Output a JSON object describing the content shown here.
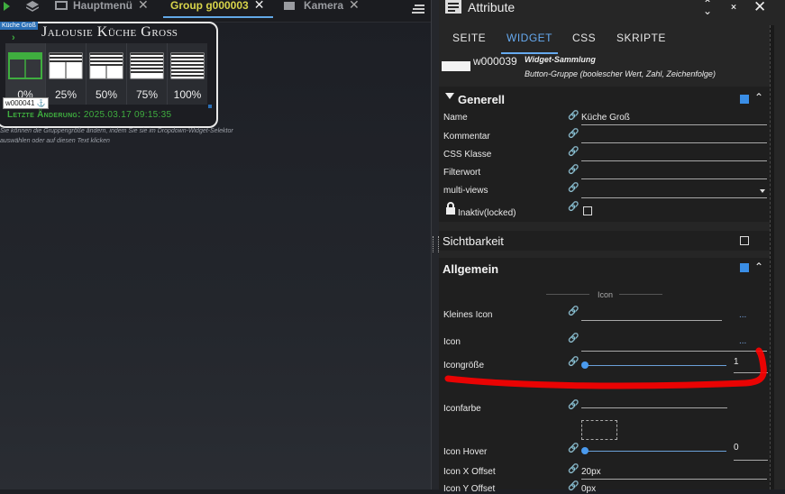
{
  "topbar": {
    "tabs": [
      {
        "label": "Hauptmenü"
      },
      {
        "label": "Group g000003"
      },
      {
        "label": "Kamera"
      }
    ]
  },
  "canvas": {
    "selection_label": "Küche Groß",
    "widget_title": "Jalousie Küche Groß",
    "widget_id": "w000041",
    "buttons": [
      {
        "label": "0%",
        "selected": true
      },
      {
        "label": "25%",
        "selected": false
      },
      {
        "label": "50%",
        "selected": false
      },
      {
        "label": "75%",
        "selected": false
      },
      {
        "label": "100%",
        "selected": false
      }
    ],
    "last_change_label": "Letzte Änderung:",
    "last_change_value": "2025.03.17 09:15:35",
    "hint": "Sie können die Gruppengröße ändern, indem Sie sie im Dropdown-Widget-Selektor auswählen oder auf diesen Text klicken"
  },
  "panel": {
    "title": "Attribute",
    "tabs": [
      "SEITE",
      "WIDGET",
      "CSS",
      "SKRIPTE"
    ],
    "active_tab": "WIDGET",
    "widget_id": "w000039",
    "widget_type": "Widget-Sammlung",
    "widget_desc": "Button-Gruppe (boolescher Wert, Zahl, Zeichenfolge)",
    "generell": {
      "title": "Generell",
      "rows": {
        "name_label": "Name",
        "name_value": "Küche Groß",
        "kommentar_label": "Kommentar",
        "css_label": "CSS Klasse",
        "filter_label": "Filterwort",
        "multiviews_label": "multi-views",
        "inaktiv_label": "Inaktiv(locked)"
      }
    },
    "sichtbarkeit": {
      "title": "Sichtbarkeit"
    },
    "allgemein": {
      "title": "Allgemein",
      "group_label": "Icon",
      "kleines_icon_label": "Kleines Icon",
      "icon_label": "Icon",
      "icongroesse_label": "Icongröße",
      "icongroesse_value": "1",
      "iconfarbe_label": "Iconfarbe",
      "icon_hover_label": "Icon Hover",
      "icon_hover_value": "0",
      "icon_x_offset_label": "Icon X Offset",
      "icon_x_offset_value": "20px",
      "icon_y_offset_label": "Icon Y Offset",
      "icon_y_offset_value": "0px",
      "dots": "..."
    }
  },
  "colors": {
    "accent": "#66aaf0",
    "highlight_tab": "#d8d44a",
    "green": "#3fae3f",
    "annotation": "#ff0000"
  }
}
